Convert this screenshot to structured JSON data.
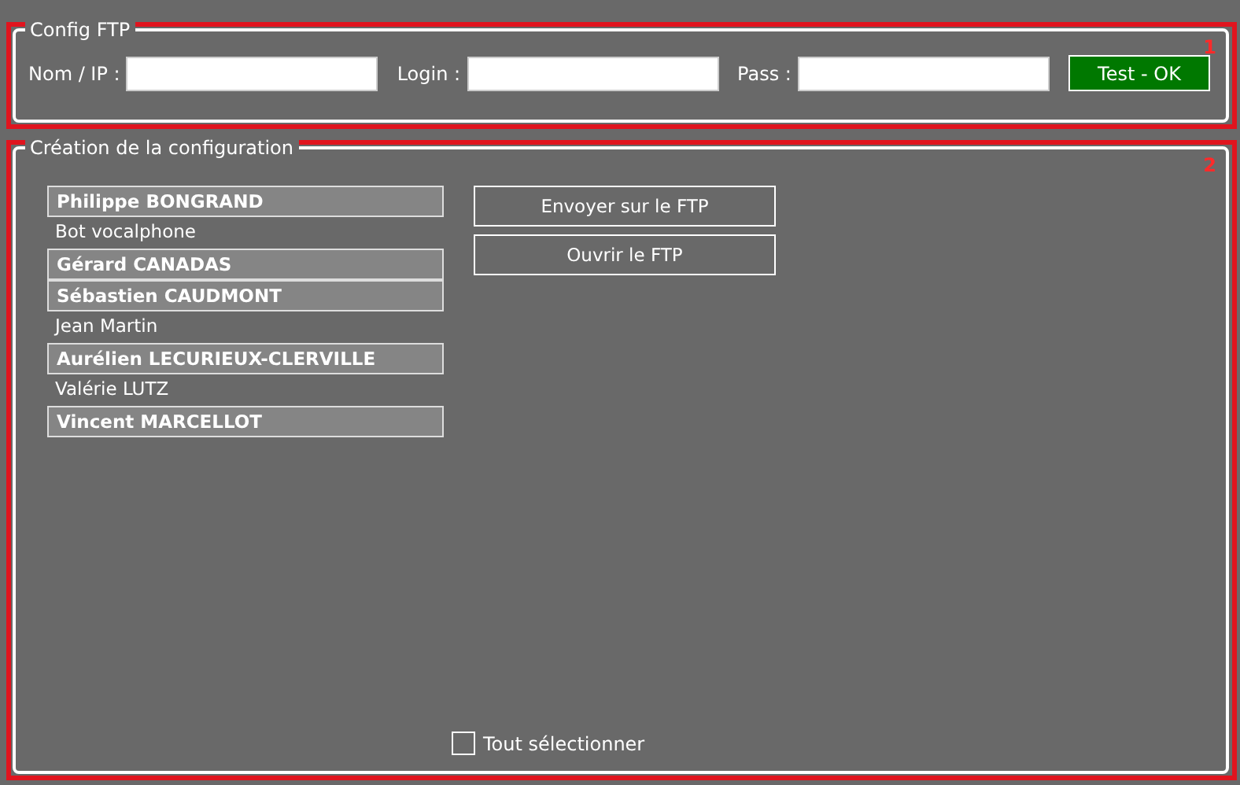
{
  "ftp": {
    "title": "Config FTP",
    "marker": "1",
    "fields": [
      {
        "label": "Nom / IP :"
      },
      {
        "label": "Login :"
      },
      {
        "label": "Pass :"
      }
    ],
    "test_button": "Test - OK"
  },
  "config": {
    "title": "Création de la configuration",
    "marker": "2",
    "people": [
      {
        "name": "Philippe BONGRAND",
        "selected": true
      },
      {
        "name": "Bot vocalphone",
        "selected": false
      },
      {
        "name": "Gérard CANADAS",
        "selected": true
      },
      {
        "name": "Sébastien CAUDMONT",
        "selected": true
      },
      {
        "name": "Jean Martin",
        "selected": false
      },
      {
        "name": "Aurélien LECURIEUX-CLERVILLE",
        "selected": true
      },
      {
        "name": "Valérie LUTZ",
        "selected": false
      },
      {
        "name": "Vincent MARCELLOT",
        "selected": true
      }
    ],
    "buttons": [
      "Envoyer sur le FTP",
      "Ouvrir le FTP"
    ],
    "select_all": {
      "label": "Tout sélectionner",
      "checked": false
    }
  }
}
